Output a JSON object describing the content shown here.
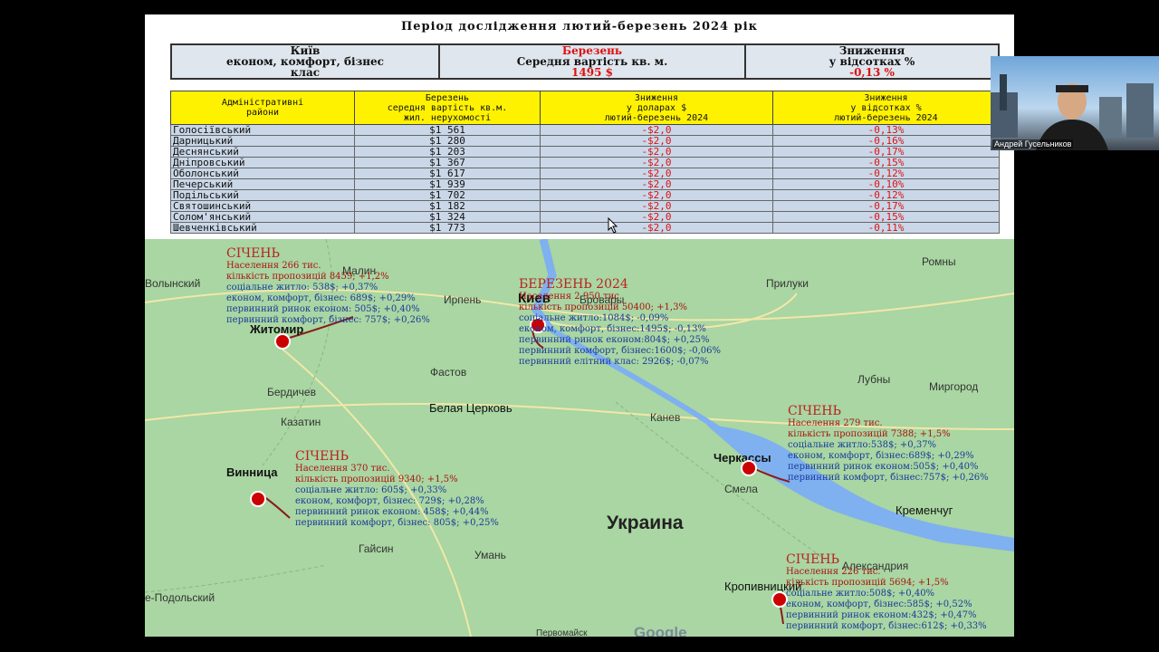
{
  "slide": {
    "title": "Період дослідження  лютий-березень  2024 рік",
    "summary": {
      "c1": [
        "Київ",
        "економ, комфорт, бізнес",
        "клас"
      ],
      "c2": [
        "Березень",
        "Середня вартість кв. м.",
        "1495 $"
      ],
      "c3": [
        "Зниження",
        "у відсотках %",
        "-0,13 %"
      ]
    },
    "table_headers": [
      [
        "Адміністративні",
        "райони"
      ],
      [
        "Березень",
        "середня вартість кв.м.",
        "жил. нерухомості"
      ],
      [
        "Зниження",
        "у доларах $",
        "лютий-березень 2024"
      ],
      [
        "Зниження",
        "у відсотках %",
        "лютий-березень 2024"
      ]
    ],
    "rows": [
      {
        "district": "Голосіївський",
        "price": "$1 561",
        "drop_usd": "-$2,0",
        "drop_pct": "-0,13%"
      },
      {
        "district": "Дарницький",
        "price": "$1 280",
        "drop_usd": "-$2,0",
        "drop_pct": "-0,16%"
      },
      {
        "district": "Деснянський",
        "price": "$1 203",
        "drop_usd": "-$2,0",
        "drop_pct": "-0,17%"
      },
      {
        "district": "Дніпровський",
        "price": "$1 367",
        "drop_usd": "-$2,0",
        "drop_pct": "-0,15%"
      },
      {
        "district": "Оболонський",
        "price": "$1 617",
        "drop_usd": "-$2,0",
        "drop_pct": "-0,12%"
      },
      {
        "district": "Печерський",
        "price": "$1 939",
        "drop_usd": "-$2,0",
        "drop_pct": "-0,10%"
      },
      {
        "district": " Подільський",
        "price": "$1 702",
        "drop_usd": "-$2,0",
        "drop_pct": "-0,12%"
      },
      {
        "district": " Святошинський",
        "price": "$1 182",
        "drop_usd": "-$2,0",
        "drop_pct": "-0,17%"
      },
      {
        "district": "Солом'янський",
        "price": "$1 324",
        "drop_usd": "-$2,0",
        "drop_pct": "-0,15%"
      },
      {
        "district": "Шевченківський",
        "price": "$1 773",
        "drop_usd": "-$2,0",
        "drop_pct": "-0,11%"
      }
    ]
  },
  "map": {
    "labels": {
      "malin": "Малин",
      "romny": "Ромны",
      "volynsky": "Волынский",
      "irpen": "Ирпень",
      "brovary": "Бровары",
      "priluki": "Прилуки",
      "fastov": "Фастов",
      "berdichev": "Бердичев",
      "lubny": "Лубны",
      "mirgorod": "Миргород",
      "kazatin": "Казатин",
      "kanev": "Канев",
      "smela": "Смела",
      "gaysin": "Гайсин",
      "uman": "Умань",
      "aleksandriya": "Александрия",
      "podilsky": "е-Подольский",
      "pervomaysk": "Первомайск"
    },
    "cities": {
      "kiev": "Киев",
      "zhitomir": "Житомир",
      "bila": "Белая Церковь",
      "vinnitsa": "Винница",
      "cherkassy": "Черкассы",
      "kremenchug": "Кременчуг",
      "kropyvnytskyi": "Кропивницкий"
    },
    "country": "Украина",
    "google": "Google",
    "zhitomir": {
      "head": "СІЧЕНЬ",
      "lines": [
        {
          "t": "Населення 266 тис.",
          "c": "r"
        },
        {
          "t": "кількість пропозицій 8459; +1,2%",
          "c": "r"
        },
        {
          "t": "соціальне житло: 538$; +0,37%",
          "c": "b"
        },
        {
          "t": "економ, комфорт, бізнес: 689$; +0,29%",
          "c": "b"
        },
        {
          "t": "первинний ринок економ: 505$; +0,40%",
          "c": "b"
        },
        {
          "t": "первинний комфорт, бізнес: 757$; +0,26%",
          "c": "b"
        }
      ]
    },
    "kiev": {
      "head": "БЕРЕЗЕНЬ 2024",
      "lines": [
        {
          "t": "Населення 2 950 тис.",
          "c": "r"
        },
        {
          "t": "кількість пропозицій 50400; +1,3%",
          "c": "r"
        },
        {
          "t": "соціальне житло:1084$; -0,09%",
          "c": "b"
        },
        {
          "t": "економ, комфорт, бізнес:1495$; -0,13%",
          "c": "b"
        },
        {
          "t": "первинний ринок економ:804$; +0,25%",
          "c": "b"
        },
        {
          "t": "первинний комфорт, бізнес:1600$; -0,06%",
          "c": "b"
        },
        {
          "t": "первинний елітний клас: 2926$; -0,07%",
          "c": "b"
        }
      ]
    },
    "vinnitsa": {
      "head": "СІЧЕНЬ",
      "lines": [
        {
          "t": "Населення 370 тис.",
          "c": "r"
        },
        {
          "t": "кількість пропозицій 9340; +1,5%",
          "c": "r"
        },
        {
          "t": "соціальне житло: 605$; +0,33%",
          "c": "b"
        },
        {
          "t": "економ, комфорт, бізнес: 729$; +0,28%",
          "c": "b"
        },
        {
          "t": "первинний ринок економ: 458$; +0,44%",
          "c": "b"
        },
        {
          "t": "первинний комфорт, бізнес: 805$; +0,25%",
          "c": "b"
        }
      ]
    },
    "cherkassy": {
      "head": "СІЧЕНЬ",
      "lines": [
        {
          "t": "Населення 279 тис.",
          "c": "r"
        },
        {
          "t": "кількість пропозицій 7388; +1,5%",
          "c": "r"
        },
        {
          "t": "соціальне житло:538$; +0,37%",
          "c": "b"
        },
        {
          "t": "економ, комфорт, бізнес:689$; +0,29%",
          "c": "b"
        },
        {
          "t": "первинний ринок економ:505$; +0,40%",
          "c": "b"
        },
        {
          "t": "первинний комфорт, бізнес:757$; +0,26%",
          "c": "b"
        }
      ]
    },
    "kropyvnytskyi": {
      "head": "СІЧЕНЬ",
      "lines": [
        {
          "t": "Населення 226 тис.",
          "c": "r"
        },
        {
          "t": "кількість пропозицій 5694; +1,5%",
          "c": "r"
        },
        {
          "t": "соціальне житло:508$; +0,40%",
          "c": "b"
        },
        {
          "t": "економ, комфорт, бізнес:585$; +0,52%",
          "c": "b"
        },
        {
          "t": "первинний ринок економ:432$; +0,47%",
          "c": "b"
        },
        {
          "t": "первинний комфорт, бізнес:612$; +0,33%",
          "c": "b"
        }
      ]
    }
  },
  "webcam": {
    "name": "Андрей Гусельников"
  },
  "colors": {
    "header_yellow": "#fff200",
    "row_blue": "#c9d7e8",
    "map_green": "#a9d6a2",
    "water": "#7fb0ef",
    "accent_red": "#d11"
  }
}
